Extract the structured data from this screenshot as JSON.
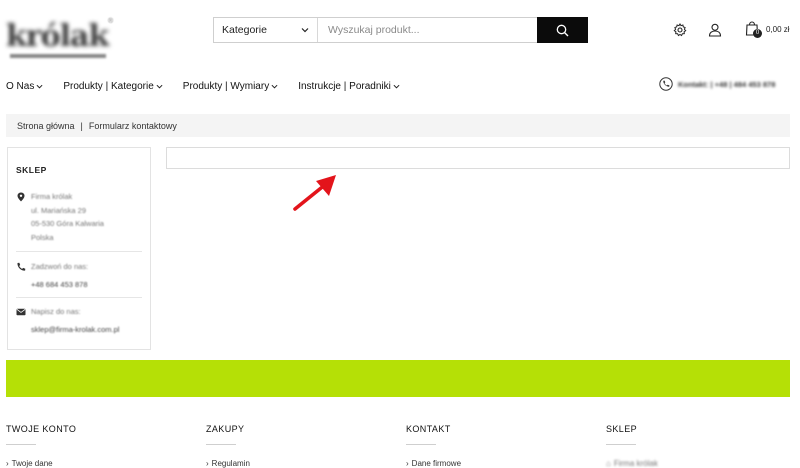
{
  "header": {
    "logo_text": "królak",
    "search": {
      "category_label": "Kategorie",
      "placeholder": "Wyszukaj produkt..."
    },
    "cart": {
      "count": "0",
      "amount": "0,00 zł"
    }
  },
  "nav": {
    "items": [
      {
        "label": "O Nas"
      },
      {
        "label": "Produkty | Kategorie"
      },
      {
        "label": "Produkty | Wymiary"
      },
      {
        "label": "Instrukcje | Poradniki"
      }
    ],
    "contact": "Kontakt: | +48 | 484 453 878"
  },
  "breadcrumb": {
    "home": "Strona główna",
    "separator": "|",
    "current": "Formularz kontaktowy"
  },
  "sidebar": {
    "title": "SKLEP",
    "address": [
      "Firma królak",
      "ul. Mariańska 29",
      "05-530 Góra Kalwaria",
      "Polska"
    ],
    "phone_label": "Zadzwoń do nas:",
    "phone": "+48 684 453 878",
    "email_label": "Napisz do nas:",
    "email": "sklep@firma-krolak.com.pl"
  },
  "footer": {
    "columns": [
      {
        "title": "TWOJE KONTO",
        "first_link": "Twoje dane"
      },
      {
        "title": "ZAKUPY",
        "first_link": "Regulamin"
      },
      {
        "title": "KONTAKT",
        "first_link": "Dane firmowe"
      },
      {
        "title": "SKLEP",
        "first_link": "Firma królak"
      }
    ]
  },
  "colors": {
    "accent_green": "#b5e006",
    "annotation_arrow": "#e3141b",
    "search_button": "#0b0b0b"
  },
  "icons": {
    "search_button": "search-icon",
    "settings": "gear-icon",
    "account": "user-icon",
    "cart": "shopping-bag-icon",
    "contact": "phone-icon",
    "sidebar_address": "map-pin-icon",
    "sidebar_phone": "phone-icon",
    "sidebar_email": "envelope-icon",
    "annotation": "red-arrow-icon"
  }
}
